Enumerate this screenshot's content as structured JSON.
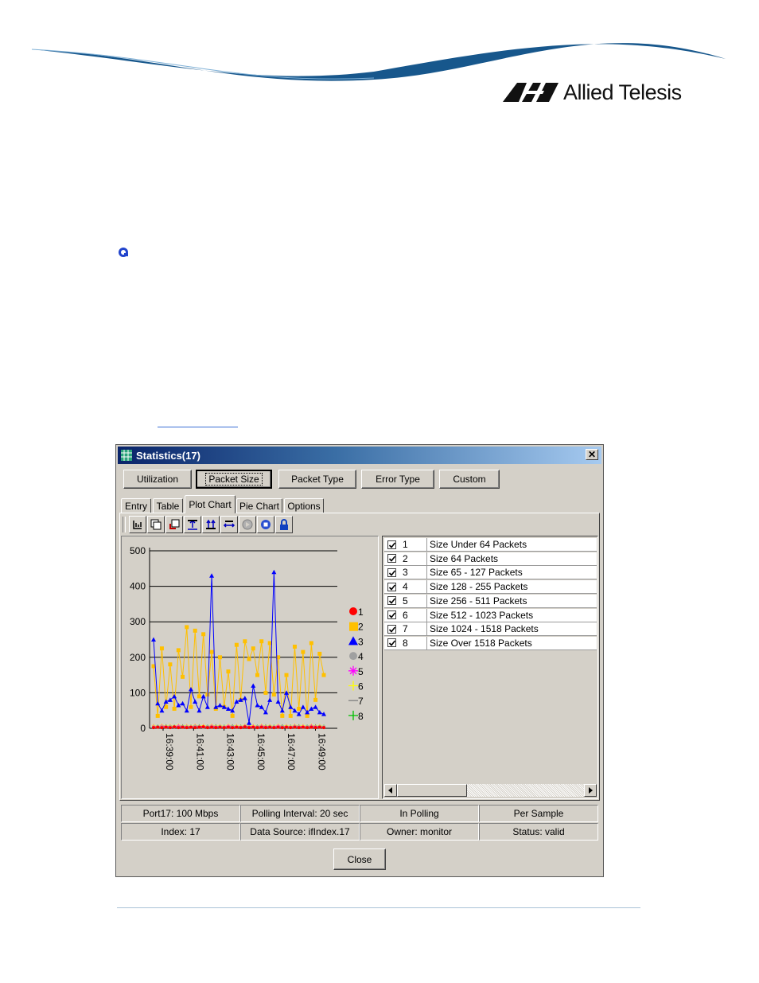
{
  "brand": {
    "name": "Allied Telesis"
  },
  "window": {
    "title": "Statistics(17)",
    "close_glyph": "✕",
    "buttons": {
      "utilization": "Utilization",
      "packet_size": "Packet Size",
      "packet_type": "Packet Type",
      "error_type": "Error Type",
      "custom": "Custom"
    },
    "tabs": [
      "Entry",
      "Table",
      "Plot Chart",
      "Pie Chart",
      "Options"
    ],
    "active_tab": "Plot Chart",
    "toolbar_icons": [
      "stack-graph-icon",
      "layered-graph-icon",
      "reset-graph-icon",
      "zoom-vertical-icon",
      "stretch-vertical-icon",
      "stretch-horizontal-icon",
      "play-icon",
      "stop-icon",
      "lock-icon"
    ],
    "list": [
      {
        "num": "1",
        "name": "Size Under 64 Packets",
        "checked": true
      },
      {
        "num": "2",
        "name": "Size 64 Packets",
        "checked": true
      },
      {
        "num": "3",
        "name": "Size 65 - 127 Packets",
        "checked": true
      },
      {
        "num": "4",
        "name": "Size 128 - 255 Packets",
        "checked": true
      },
      {
        "num": "5",
        "name": "Size 256 - 511 Packets",
        "checked": true
      },
      {
        "num": "6",
        "name": "Size 512 - 1023 Packets",
        "checked": true
      },
      {
        "num": "7",
        "name": "Size 1024 - 1518 Packets",
        "checked": true
      },
      {
        "num": "8",
        "name": "Size Over 1518 Packets",
        "checked": true
      }
    ],
    "status": {
      "port": "Port17: 100 Mbps",
      "polling_interval": "Polling Interval: 20 sec",
      "polling_state": "In Polling",
      "mode": "Per Sample",
      "index": "Index: 17",
      "data_source": "Data Source: ifIndex.17",
      "owner": "Owner: monitor",
      "status": "Status: valid"
    },
    "close_label": "Close"
  },
  "chart_data": {
    "type": "line",
    "ylim": [
      0,
      500
    ],
    "yticks": [
      0,
      100,
      200,
      300,
      400,
      500
    ],
    "x_ticks": [
      "16:39:00",
      "16:41:00",
      "16:43:00",
      "16:45:00",
      "16:47:00",
      "16:49:00"
    ],
    "legend": [
      "1",
      "2",
      "3",
      "4",
      "5",
      "6",
      "7",
      "8"
    ],
    "legend_colors": [
      "#ff0000",
      "#ffc000",
      "#0000ff",
      "#a0a0a0",
      "#ff00ff",
      "#ffff00",
      "#808080",
      "#00c000"
    ],
    "legend_markers": [
      "circle",
      "square",
      "triangle",
      "circle",
      "asterisk",
      "plus",
      "dash",
      "plus"
    ],
    "series": [
      {
        "name": "1",
        "values": [
          2,
          3,
          2,
          3,
          2,
          4,
          2,
          3,
          2,
          3,
          2,
          3,
          4,
          2,
          3,
          2,
          3,
          2,
          3,
          2,
          3,
          2,
          4,
          2,
          3,
          2,
          3,
          2,
          3,
          2,
          3,
          2,
          3,
          2,
          3,
          2,
          3,
          2,
          3,
          2,
          3,
          2
        ]
      },
      {
        "name": "2",
        "values": [
          175,
          35,
          225,
          60,
          180,
          55,
          220,
          145,
          285,
          60,
          275,
          90,
          265,
          95,
          215,
          55,
          200,
          60,
          160,
          35,
          235,
          80,
          245,
          195,
          225,
          150,
          245,
          100,
          240,
          95,
          200,
          35,
          150,
          35,
          230,
          55,
          215,
          35,
          240,
          80,
          210,
          150
        ]
      },
      {
        "name": "3",
        "values": [
          250,
          70,
          50,
          75,
          80,
          90,
          65,
          70,
          50,
          110,
          75,
          50,
          90,
          60,
          430,
          60,
          65,
          60,
          55,
          50,
          75,
          80,
          85,
          15,
          120,
          65,
          60,
          45,
          80,
          440,
          75,
          50,
          100,
          60,
          50,
          40,
          60,
          45,
          55,
          60,
          45,
          40
        ]
      },
      {
        "name": "4",
        "values": [
          3,
          5,
          4,
          3,
          5,
          4,
          3,
          5,
          4,
          3,
          5,
          4,
          3,
          5,
          4,
          3,
          5,
          4,
          3,
          5,
          4,
          3,
          5,
          4,
          3,
          5,
          4,
          3,
          5,
          4,
          3,
          5,
          4,
          3,
          5,
          4,
          3,
          5,
          4,
          3,
          5,
          4
        ]
      },
      {
        "name": "5",
        "values": [
          6,
          4,
          7,
          5,
          6,
          4,
          7,
          5,
          6,
          4,
          7,
          5,
          6,
          4,
          7,
          5,
          6,
          4,
          7,
          5,
          6,
          4,
          7,
          5,
          6,
          4,
          7,
          5,
          6,
          4,
          7,
          5,
          6,
          4,
          7,
          5,
          6,
          4,
          7,
          5,
          6,
          4
        ]
      },
      {
        "name": "6",
        "values": [
          8,
          5,
          9,
          6,
          8,
          5,
          9,
          6,
          8,
          5,
          9,
          6,
          8,
          5,
          9,
          6,
          8,
          5,
          9,
          6,
          8,
          5,
          9,
          6,
          8,
          5,
          9,
          6,
          8,
          5,
          9,
          6,
          8,
          5,
          9,
          6,
          8,
          5,
          9,
          6,
          8,
          5
        ]
      },
      {
        "name": "7",
        "values": [
          1,
          1,
          1,
          1,
          1,
          1,
          1,
          1,
          1,
          1,
          1,
          1,
          1,
          1,
          1,
          1,
          1,
          1,
          1,
          1,
          1,
          1,
          1,
          1,
          1,
          1,
          1,
          1,
          1,
          1,
          1,
          1,
          1,
          1,
          1,
          1,
          1,
          1,
          1,
          1,
          1,
          1
        ]
      },
      {
        "name": "8",
        "values": [
          4,
          6,
          5,
          7,
          4,
          6,
          5,
          7,
          4,
          6,
          5,
          7,
          4,
          6,
          5,
          7,
          4,
          6,
          5,
          7,
          4,
          6,
          5,
          7,
          4,
          6,
          5,
          7,
          4,
          6,
          5,
          7,
          4,
          6,
          5,
          7,
          4,
          6,
          5,
          7,
          4,
          6
        ]
      }
    ]
  }
}
